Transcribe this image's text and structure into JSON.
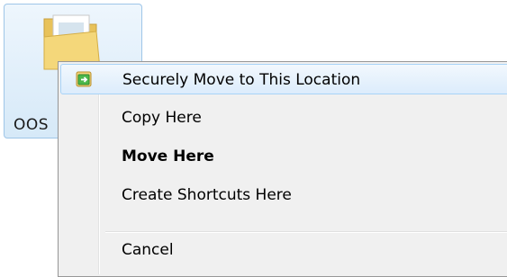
{
  "desktop": {
    "icon_label": "OOS",
    "icon": "folder-icon"
  },
  "context_menu": {
    "items": [
      {
        "label": "Securely Move to This Location",
        "icon": "secure-move-icon",
        "highlighted": true
      },
      {
        "label": "Copy Here"
      },
      {
        "label": "Move Here",
        "default": true
      },
      {
        "label": "Create Shortcuts Here"
      },
      {
        "label": "Cancel"
      }
    ]
  },
  "colors": {
    "menu_background": "#f0f0f0",
    "highlight_border": "#a8d3f7",
    "icon_green": "#3aa53a"
  }
}
